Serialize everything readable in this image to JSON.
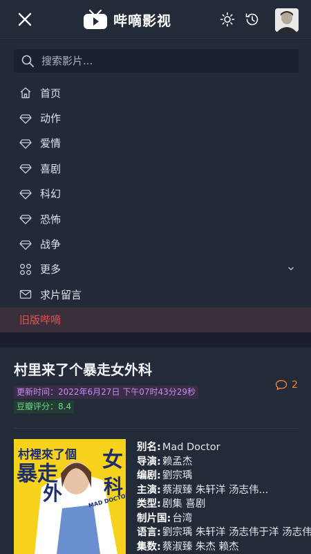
{
  "header": {
    "app_name": "哔嘀影视",
    "icons": [
      "close-icon",
      "sun-icon",
      "history-icon",
      "user-avatar"
    ]
  },
  "search": {
    "placeholder": "搜索影片..."
  },
  "menu": {
    "items": [
      {
        "label": "首页",
        "icon": "home-icon"
      },
      {
        "label": "动作",
        "icon": "diamond-icon"
      },
      {
        "label": "爱情",
        "icon": "diamond-icon"
      },
      {
        "label": "喜剧",
        "icon": "diamond-icon"
      },
      {
        "label": "科幻",
        "icon": "diamond-icon"
      },
      {
        "label": "恐怖",
        "icon": "diamond-icon"
      },
      {
        "label": "战争",
        "icon": "diamond-icon"
      },
      {
        "label": "更多",
        "icon": "grid-icon"
      },
      {
        "label": "求片留言",
        "icon": "mail-icon"
      }
    ],
    "old_version": "旧版哔嘀"
  },
  "detail": {
    "title": "村里来了个暴走女外科",
    "update_time": "更新时间：2022年6月27日 下午07时43分29秒",
    "douban": "豆瓣评分：8.4",
    "comment_count": "2",
    "poster_text": {
      "line1": "村裡來了個",
      "line2": "暴走",
      "line3": "女",
      "line4": "外",
      "line5": "科",
      "en": "MAD DOCTOR"
    },
    "info": [
      {
        "key": "别名:",
        "value": "Mad Doctor"
      },
      {
        "key": "导演:",
        "value": "赖孟杰"
      },
      {
        "key": "编剧:",
        "value": "劉宗瑀"
      },
      {
        "key": "主演:",
        "value": "蔡淑臻  朱轩洋  汤志伟..."
      },
      {
        "key": "类型:",
        "value": "剧集  喜剧"
      },
      {
        "key": "制片国:",
        "value": "台湾"
      },
      {
        "key": "语言:",
        "value": "劉宗瑀  朱轩洋  汤志伟于洋  汤志伟"
      },
      {
        "key": "集数:",
        "value": "蔡淑臻  朱杰       赖杰"
      }
    ]
  },
  "colors": {
    "background": "#1e2431",
    "old_version_text": "#d9584f",
    "update_badge_text": "#c58cf0",
    "score_badge_text": "#6dd48e",
    "comment_accent": "#f0853a",
    "poster_yellow": "#f5d31c"
  }
}
